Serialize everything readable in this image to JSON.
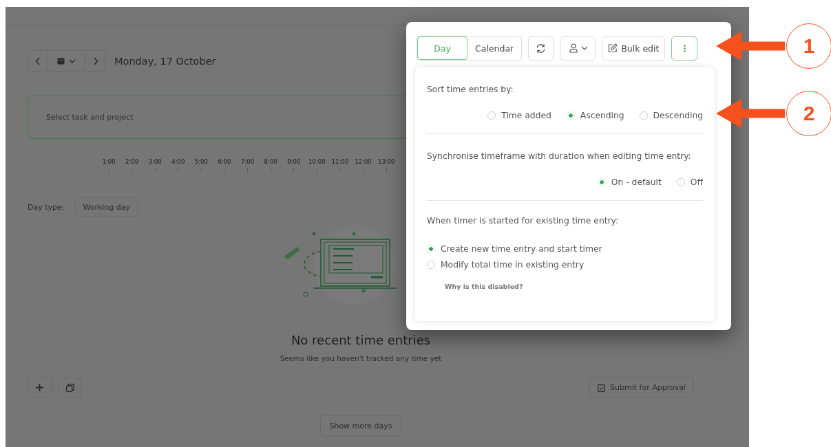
{
  "date_nav": {
    "date": "Monday, 17 October"
  },
  "task_field": {
    "placeholder": "Select task and project"
  },
  "timeline": {
    "hours": [
      "1:00",
      "2:00",
      "3:00",
      "4:00",
      "5:00",
      "6:00",
      "7:00",
      "8:00",
      "9:00",
      "10:00",
      "11:00",
      "12:00",
      "13:00"
    ]
  },
  "day_type": {
    "label": "Day type:",
    "value": "Working day"
  },
  "empty_state": {
    "title": "No recent time entries",
    "subtitle": "Seems like you haven't tracked any time yet"
  },
  "actions": {
    "submit": "Submit for Approval",
    "show_more": "Show more days"
  },
  "toolbar": {
    "view_tabs": [
      {
        "label": "Day",
        "selected": true
      },
      {
        "label": "Calendar",
        "selected": false
      }
    ],
    "bulk_edit": "Bulk edit",
    "more_open": true
  },
  "settings": {
    "sections": [
      {
        "title": "Sort time entries by:",
        "kind": "row",
        "options": [
          {
            "label": "Time added",
            "selected": false
          },
          {
            "label": "Ascending",
            "selected": true
          },
          {
            "label": "Descending",
            "selected": false
          }
        ]
      },
      {
        "title": "Synchronise timeframe with duration when editing time entry:",
        "kind": "row",
        "options": [
          {
            "label": "On - default",
            "selected": true
          },
          {
            "label": "Off",
            "selected": false
          }
        ]
      },
      {
        "title": "When timer is started for existing time entry:",
        "kind": "column",
        "options": [
          {
            "label": "Create new time entry and start timer",
            "selected": true
          },
          {
            "label": "Modify total time in existing entry",
            "selected": false
          }
        ],
        "note": "Why is this disabled?"
      }
    ]
  },
  "annotations": [
    {
      "number": "1"
    },
    {
      "number": "2"
    }
  ]
}
